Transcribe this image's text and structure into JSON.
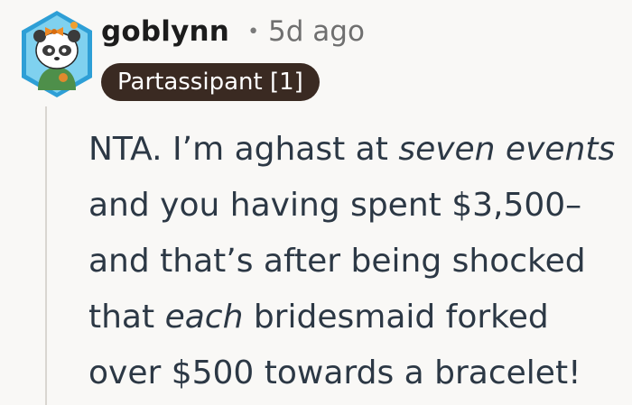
{
  "comment": {
    "username": "goblynn",
    "separator": "•",
    "timestamp": "5d ago",
    "flair": "Partassipant [1]",
    "body_lines": [
      [
        {
          "text": "NTA. I’m aghast at "
        },
        {
          "text": "seven events",
          "italic": true
        }
      ],
      [
        {
          "text": "and you having spent $3,500–"
        }
      ],
      [
        {
          "text": "and that’s after being shocked"
        }
      ],
      [
        {
          "text": "that "
        },
        {
          "text": "each",
          "italic": true
        },
        {
          "text": " bridesmaid forked"
        }
      ],
      [
        {
          "text": "over $500 towards a bracelet!"
        }
      ]
    ]
  },
  "colors": {
    "background": "#f9f8f6",
    "username": "#1c1c1c",
    "meta": "#6f6f6f",
    "flair_bg": "#3a2a22",
    "flair_text": "#ffffff",
    "body_text": "#2c3845",
    "thread_line": "#d9d6d1",
    "avatar_frame": "#2e9fd6",
    "avatar_bg": "#7fd1ef"
  },
  "icons": {
    "avatar": "snoo-avatar-panda-with-bow"
  }
}
